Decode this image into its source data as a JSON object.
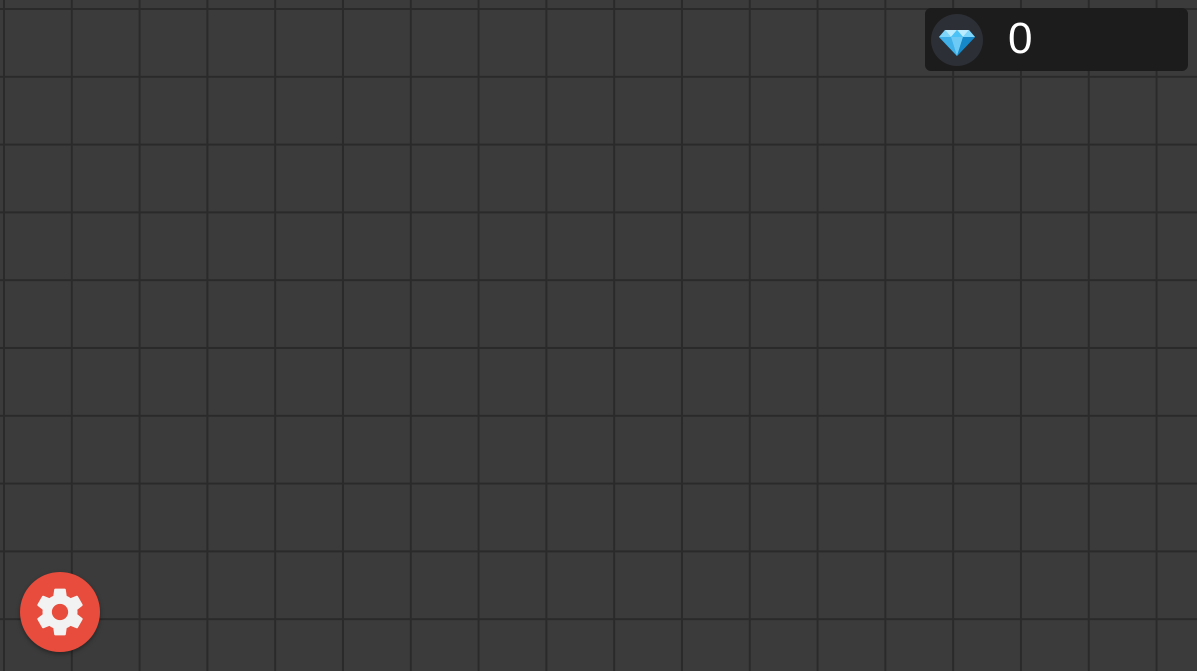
{
  "hud": {
    "gem_icon": "gem-icon",
    "gem_count": "0"
  },
  "settings": {
    "icon": "gear-icon"
  },
  "colors": {
    "background": "#3b3b3b",
    "grid_line": "#2a2a2a",
    "hud_panel": "#1c1c1c",
    "gem_blue": "#29b6f6",
    "settings_red": "#e74c3c"
  }
}
